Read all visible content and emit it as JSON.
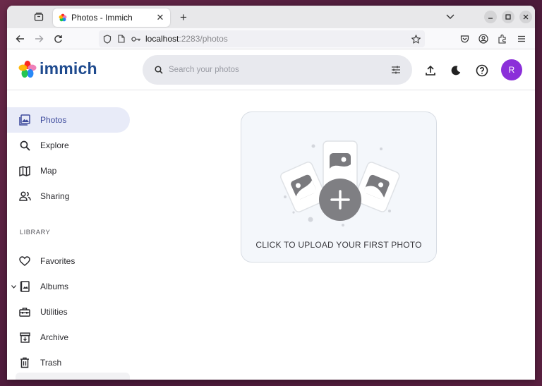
{
  "browser": {
    "tab_title": "Photos - Immich",
    "url_host": "localhost",
    "url_rest": ":2283/photos"
  },
  "app": {
    "brand": "immich",
    "search_placeholder": "Search your photos",
    "avatar_initial": "R",
    "avatar_color": "#8b2fd9",
    "accent_color": "#3d4a9c"
  },
  "sidebar": {
    "items": [
      {
        "label": "Photos",
        "icon": "photos-icon",
        "active": true
      },
      {
        "label": "Explore",
        "icon": "search-icon"
      },
      {
        "label": "Map",
        "icon": "map-icon"
      },
      {
        "label": "Sharing",
        "icon": "people-icon"
      }
    ],
    "library_heading": "LIBRARY",
    "library_items": [
      {
        "label": "Favorites",
        "icon": "heart-icon"
      },
      {
        "label": "Albums",
        "icon": "album-icon"
      },
      {
        "label": "Utilities",
        "icon": "toolbox-icon"
      },
      {
        "label": "Archive",
        "icon": "archive-icon"
      },
      {
        "label": "Trash",
        "icon": "trash-icon"
      }
    ]
  },
  "main": {
    "upload_prompt": "CLICK TO UPLOAD YOUR FIRST PHOTO"
  }
}
